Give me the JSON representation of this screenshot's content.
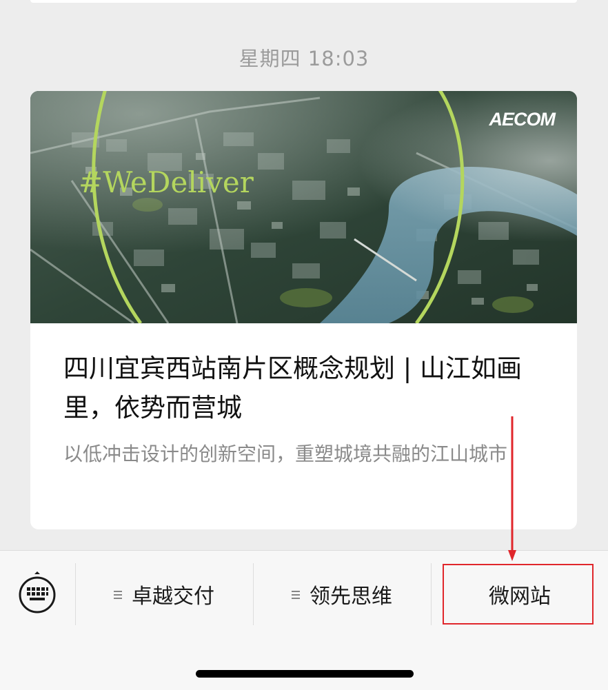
{
  "chat": {
    "timestamp": "星期四 18:03"
  },
  "article": {
    "cover": {
      "brand": "AECOM",
      "hashtag": "#WeDeliver",
      "accent_color": "#b4d65e"
    },
    "title": "四川宜宾西站南片区概念规划 | 山江如画里，依势而营城",
    "summary": "以低冲击设计的创新空间，重塑城境共融的江山城市"
  },
  "menu": {
    "keyboard_icon": "keyboard-icon",
    "items": [
      {
        "label": "卓越交付",
        "has_submenu": true,
        "icon": "submenu-lines-icon"
      },
      {
        "label": "领先思维",
        "has_submenu": true,
        "icon": "submenu-lines-icon"
      },
      {
        "label": "微网站",
        "has_submenu": false
      }
    ]
  },
  "annotation": {
    "color": "#e0262b"
  }
}
